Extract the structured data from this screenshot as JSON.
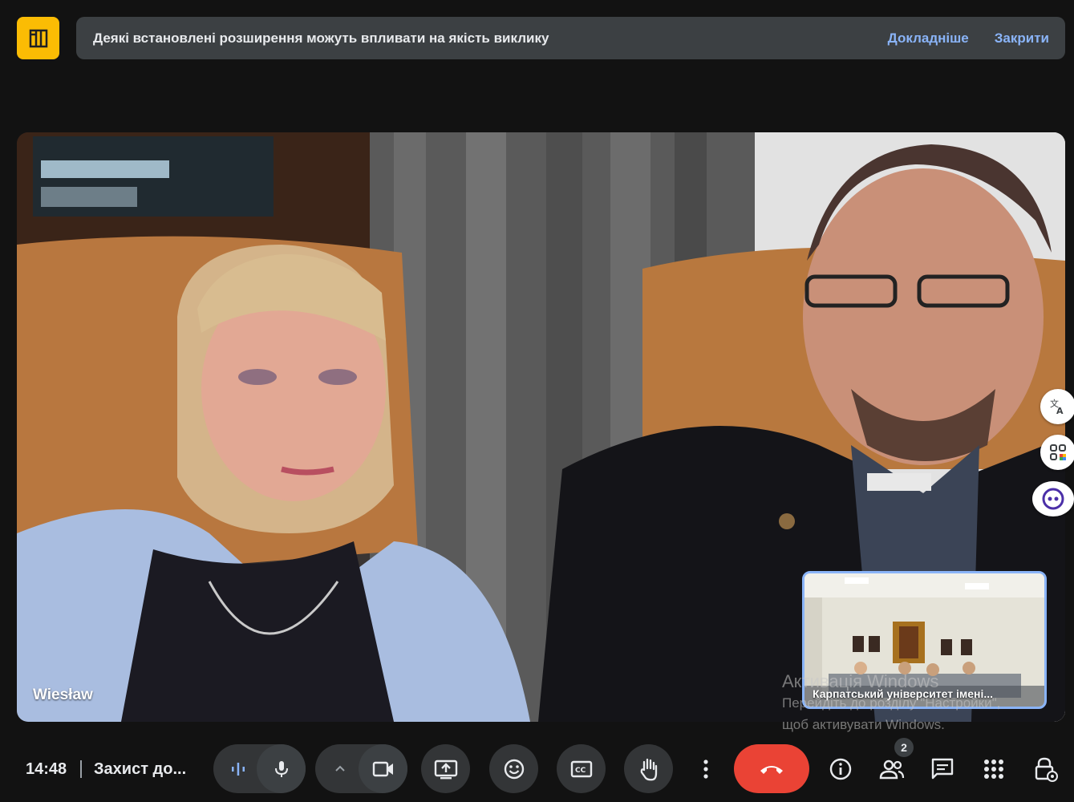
{
  "banner": {
    "message": "Деякі встановлені розширення можуть впливати на якість виклику",
    "learn_more": "Докладніше",
    "close": "Закрити"
  },
  "main_tile": {
    "name": "Wiesław"
  },
  "pip_tile": {
    "name": "Карпатський університет імені..."
  },
  "watermark": {
    "line1": "Активація Windows",
    "line2": "Перейдіть до розділу \"Настройки\",",
    "line3": "щоб активувати Windows."
  },
  "bottom_bar": {
    "time": "14:48",
    "meeting_title": "Захист до...",
    "participants_count": "2"
  },
  "side_panel": {
    "icons": [
      "translate-icon",
      "apps-icon",
      "assistant-icon"
    ]
  },
  "controls": {
    "icons": [
      "audio-levels-icon",
      "microphone-icon",
      "chevron-up-icon",
      "camera-icon",
      "present-screen-icon",
      "emoji-icon",
      "captions-icon",
      "raise-hand-icon",
      "more-options-icon",
      "end-call-icon",
      "info-icon",
      "people-icon",
      "chat-icon",
      "activities-icon",
      "host-controls-icon"
    ]
  },
  "colors": {
    "accent": "#8ab4f8",
    "end_call": "#ea4335",
    "extension_icon": "#fbbc04",
    "banner_bg": "#3c4043",
    "control_bg": "#333537"
  }
}
